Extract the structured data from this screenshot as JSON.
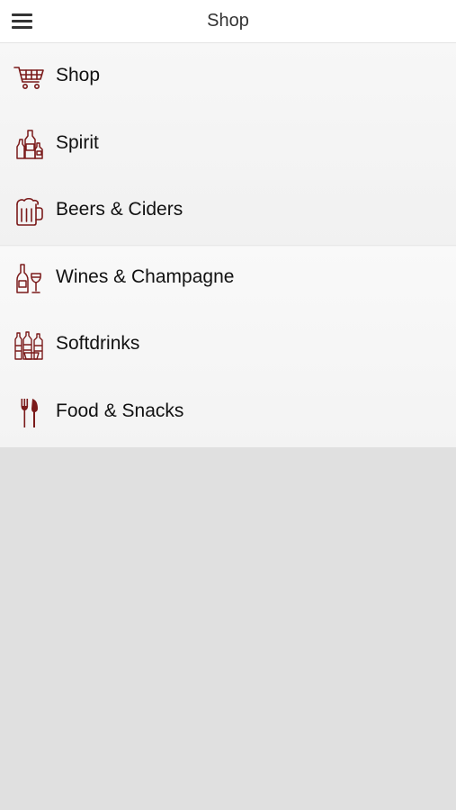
{
  "header": {
    "title": "Shop",
    "menu_icon": "hamburger-icon"
  },
  "menu": {
    "icon_color": "#7a1a1a",
    "items": [
      {
        "label": "Shop",
        "icon": "shopping-cart-icon"
      },
      {
        "label": "Spirit",
        "icon": "spirit-bottles-icon"
      },
      {
        "label": "Beers & Ciders",
        "icon": "beer-mug-icon"
      },
      {
        "label": "Wines & Champagne",
        "icon": "wine-bottle-glass-icon"
      },
      {
        "label": "Softdrinks",
        "icon": "softdrink-bottles-icon"
      },
      {
        "label": "Food & Snacks",
        "icon": "fork-knife-icon"
      }
    ]
  }
}
